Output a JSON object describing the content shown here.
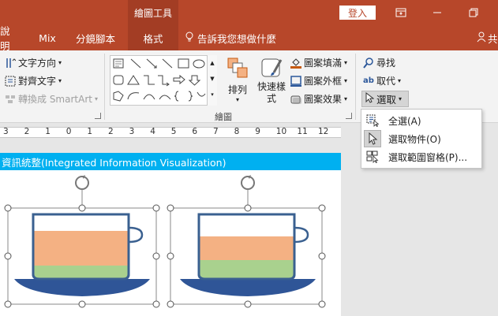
{
  "titlebar": {
    "context_tool": "繪圖工具",
    "signin": "登入",
    "bg_color": "#b7472a"
  },
  "tabs": [
    {
      "label": "說明"
    },
    {
      "label": "Mix"
    },
    {
      "label": "分鏡腳本"
    },
    {
      "label": "格式",
      "active": true
    }
  ],
  "tellme": "告訴我您想做什麼",
  "share": "共",
  "ribbon": {
    "text_direction": "文字方向",
    "align_text": "對齊文字",
    "smartart": "轉換成 SmartArt",
    "arrange": "排列",
    "quick_styles": "快速樣式",
    "shape_fill": "圖案填滿",
    "shape_outline": "圖案外框",
    "shape_effects": "圖案效果",
    "drawing_group": "繪圖",
    "find": "尋找",
    "replace": "取代",
    "select": "選取"
  },
  "ruler": {
    "numbers": [
      "3",
      "2",
      "1",
      "0",
      "1",
      "2",
      "3",
      "4",
      "5",
      "6",
      "7",
      "8",
      "9",
      "10",
      "11",
      "12"
    ]
  },
  "slide": {
    "title": "資訊統整(Integrated Information Visualization)"
  },
  "select_menu": {
    "items": [
      {
        "label": "全選(A)"
      },
      {
        "label": "選取物件(O)"
      },
      {
        "label": "選取範圍窗格(P)..."
      }
    ]
  },
  "colors": {
    "accent": "#b7472a",
    "slide_title_bar": "#00b0f0",
    "cup_outline": "#3a6090",
    "saucer": "#2f5597",
    "cup_top_fill": "#f4b183",
    "cup_bottom_fill": "#a9d18e"
  }
}
